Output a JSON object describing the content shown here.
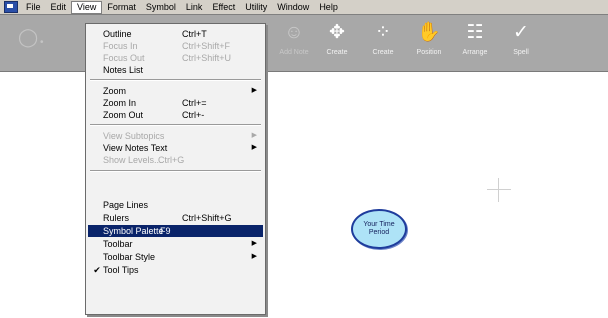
{
  "menubar": {
    "items": [
      "File",
      "Edit",
      "View",
      "Format",
      "Symbol",
      "Link",
      "Effect",
      "Utility",
      "Window",
      "Help"
    ]
  },
  "toolbar": {
    "tools": [
      {
        "label": "Add Note",
        "icon": "add-note-icon",
        "glyph": "☺"
      },
      {
        "label": "Create",
        "icon": "create-link-icon",
        "glyph": "✥"
      },
      {
        "label": "Create",
        "icon": "create-symbol-icon",
        "glyph": "⁘"
      },
      {
        "label": "Position",
        "icon": "position-hand-icon",
        "glyph": "✋"
      },
      {
        "label": "Arrange",
        "icon": "arrange-icon",
        "glyph": "☷"
      },
      {
        "label": "Spell",
        "icon": "spell-check-icon",
        "glyph": "✓"
      }
    ]
  },
  "view_menu": {
    "items": [
      {
        "label": "Outline",
        "shortcut": "Ctrl+T",
        "disabled": false
      },
      {
        "label": "Focus In",
        "shortcut": "Ctrl+Shift+F",
        "disabled": true
      },
      {
        "label": "Focus Out",
        "shortcut": "Ctrl+Shift+U",
        "disabled": true
      },
      {
        "label": "Notes List",
        "shortcut": "",
        "disabled": false
      },
      {
        "label": "Zoom",
        "shortcut": "",
        "submenu": true,
        "disabled": false
      },
      {
        "label": "Zoom In",
        "shortcut": "Ctrl+=",
        "disabled": false
      },
      {
        "label": "Zoom Out",
        "shortcut": "Ctrl+-",
        "disabled": false
      },
      {
        "label": "View Subtopics",
        "shortcut": "",
        "submenu": true,
        "disabled": true
      },
      {
        "label": "View Notes Text",
        "shortcut": "",
        "submenu": true,
        "disabled": false
      },
      {
        "label": "Show Levels...",
        "shortcut": "Ctrl+G",
        "disabled": true
      },
      {
        "label": "Page Lines",
        "shortcut": "",
        "disabled": false
      },
      {
        "label": "Rulers",
        "shortcut": "Ctrl+Shift+G",
        "disabled": false
      },
      {
        "label": "Symbol Palette",
        "shortcut": "F9",
        "highlighted": true,
        "disabled": false
      },
      {
        "label": "Toolbar",
        "shortcut": "",
        "submenu": true,
        "disabled": false
      },
      {
        "label": "Toolbar Style",
        "shortcut": "",
        "submenu": true,
        "disabled": false
      },
      {
        "label": "Tool Tips",
        "shortcut": "",
        "checked": true,
        "disabled": false
      }
    ]
  },
  "canvas": {
    "symbol_text": "Your Time Period"
  },
  "icons": {
    "submenu_arrow": "▶",
    "check": "✔"
  },
  "colors": {
    "highlight": "#0a246a",
    "bubble_fill": "#aee3f7",
    "bubble_border": "#1e3c9c"
  }
}
